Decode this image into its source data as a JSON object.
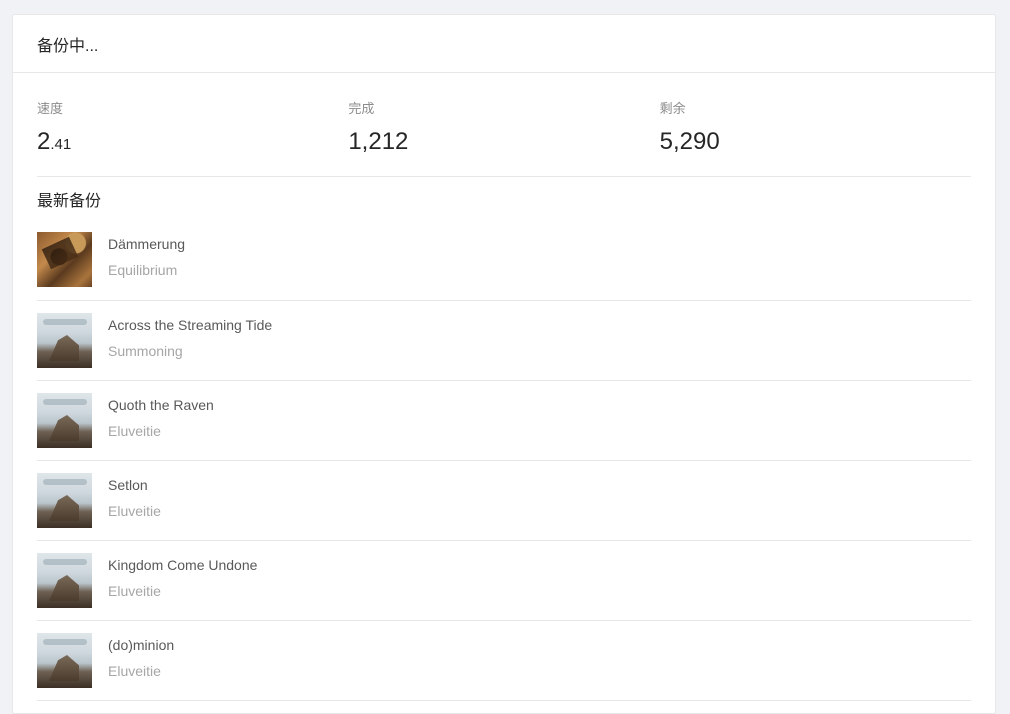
{
  "header": {
    "title": "备份中..."
  },
  "stats": {
    "speed": {
      "label": "速度",
      "integer": "2",
      "decimal": ".41"
    },
    "done": {
      "label": "完成",
      "value": "1,212"
    },
    "remaining": {
      "label": "剩余",
      "value": "5,290"
    }
  },
  "recent": {
    "title": "最新备份",
    "items": [
      {
        "title": "Dämmerung",
        "artist": "Equilibrium",
        "cover": "album-cover-brown"
      },
      {
        "title": "Across the Streaming Tide",
        "artist": "Summoning",
        "cover": "album-cover-mist"
      },
      {
        "title": "Quoth the Raven",
        "artist": "Eluveitie",
        "cover": "album-cover-mist"
      },
      {
        "title": "Setlon",
        "artist": "Eluveitie",
        "cover": "album-cover-mist"
      },
      {
        "title": "Kingdom Come Undone",
        "artist": "Eluveitie",
        "cover": "album-cover-mist"
      },
      {
        "title": "(do)minion",
        "artist": "Eluveitie",
        "cover": "album-cover-mist"
      }
    ]
  }
}
